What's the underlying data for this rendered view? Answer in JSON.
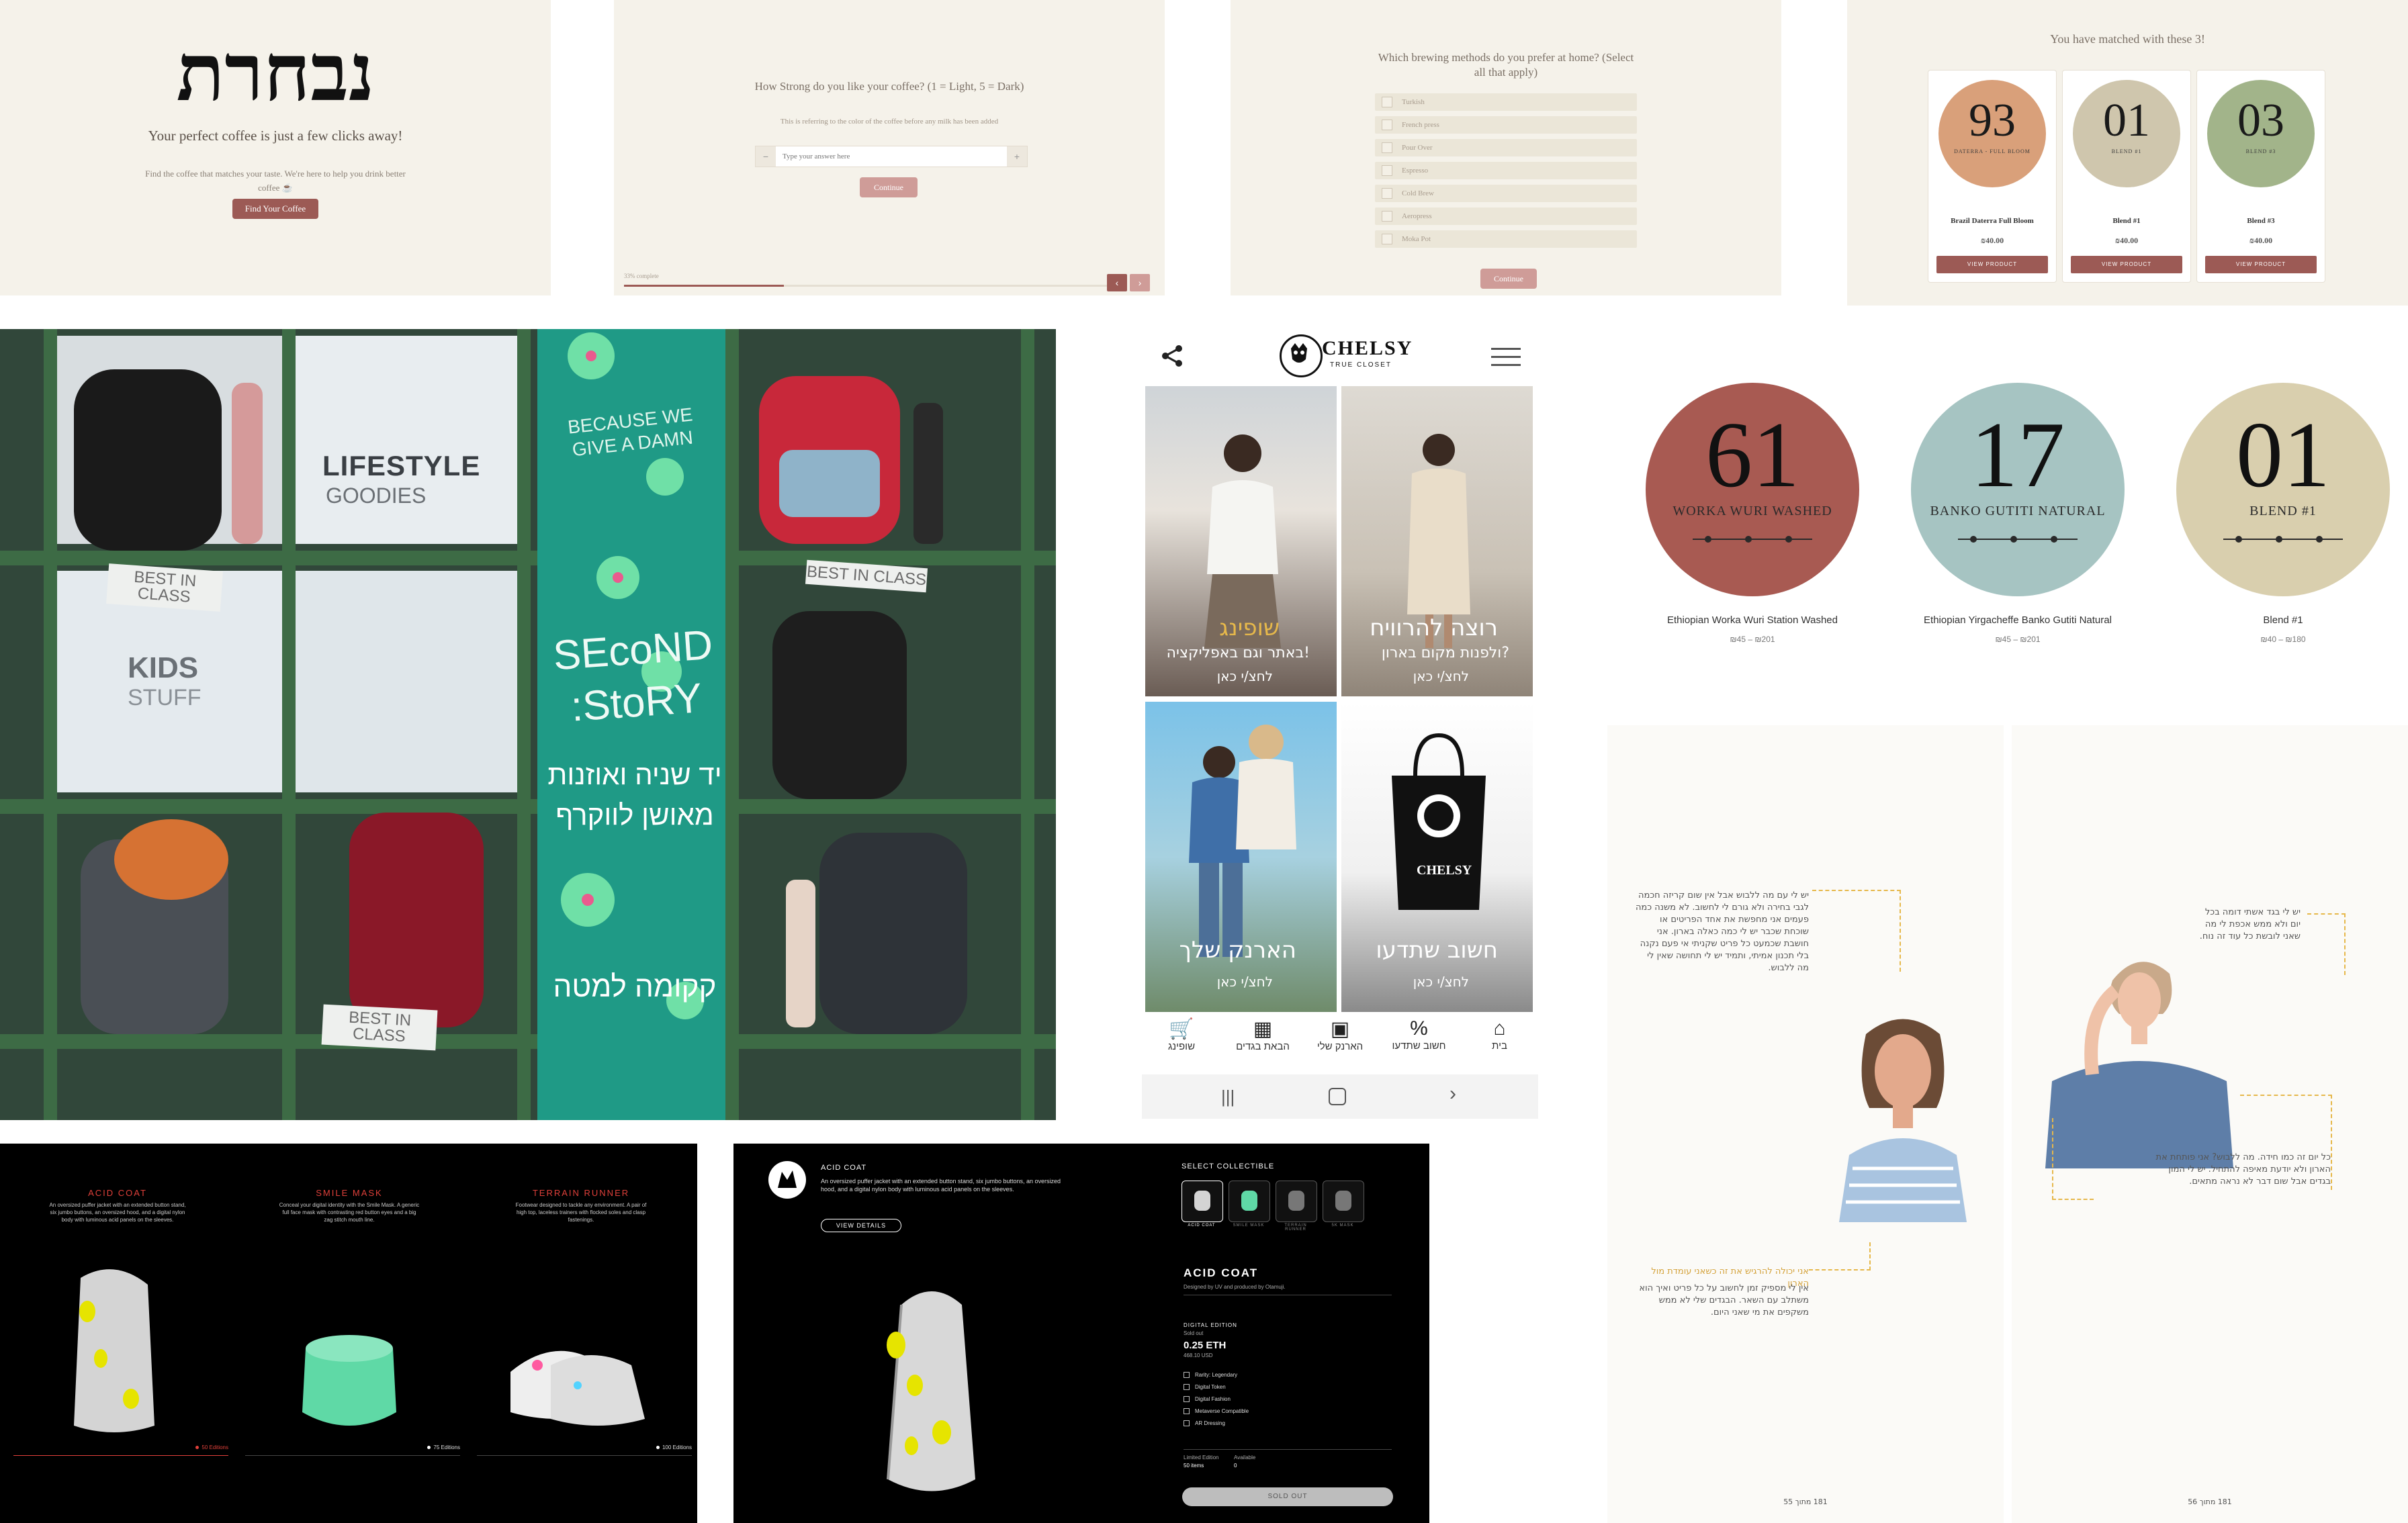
{
  "quiz_intro": {
    "logo": "נבחרת",
    "tagline": "Your perfect coffee is just a few clicks away!",
    "description": "Find the coffee that matches your taste. We're here to help you drink better coffee ☕",
    "cta": "Find Your Coffee"
  },
  "quiz_strength": {
    "question": "How Strong do you like your coffee? (1 = Light, 5 = Dark)",
    "hint": "This is referring to the color of the coffee before any milk has been added",
    "input_placeholder": "Type your answer here",
    "minus": "−",
    "plus": "+",
    "continue": "Continue",
    "progress_text": "33% complete",
    "progress_value": 0.33,
    "prev": "‹",
    "next": "›"
  },
  "quiz_brewing": {
    "question": "Which brewing methods do you prefer at home? (Select all that apply)",
    "options": [
      "Turkish",
      "French press",
      "Pour Over",
      "Espresso",
      "Cold Brew",
      "Aeropress",
      "Moka Pot"
    ],
    "continue": "Continue"
  },
  "quiz_results": {
    "title": "You have matched with these 3!",
    "products": [
      {
        "score": "93",
        "label": "DATERRA - FULL BLOOM",
        "color": "#d9a07a",
        "name": "Brazil Daterra Full Bloom",
        "price": "₪40.00",
        "button": "VIEW PRODUCT"
      },
      {
        "score": "01",
        "label": "BLEND #1",
        "color": "#cfc6ad",
        "name": "Blend #1",
        "price": "₪40.00",
        "button": "VIEW PRODUCT"
      },
      {
        "score": "03",
        "label": "BLEND #3",
        "color": "#a2b48a",
        "name": "Blend #3",
        "price": "₪40.00",
        "button": "VIEW PRODUCT"
      }
    ]
  },
  "labels": {
    "items": [
      {
        "score": "61",
        "label": "WORKA WURI WASHED",
        "color": "#a85a52",
        "name": "Ethiopian Worka Wuri Station Washed",
        "price": "₪45 – ₪201"
      },
      {
        "score": "17",
        "label": "BANKO GUTITI NATURAL",
        "color": "#a6c4c2",
        "name": "Ethiopian Yirgacheffe Banko Gutiti Natural",
        "price": "₪45 – ₪201"
      },
      {
        "score": "01",
        "label": "BLEND #1",
        "color": "#d9cfae",
        "name": "Blend #1",
        "price": "₪40 – ₪180"
      }
    ]
  },
  "store_photo": {
    "sign_lifestyle": "LIFESTYLE",
    "sign_goodies": "GOODIES",
    "sign_kids": "KIDS",
    "sign_stuff": "STUFF",
    "banner_top": "BECAUSE WE GIVE A DAMN",
    "banner_mid": "SEcoND :StoRY",
    "banner_heb1": "יד שניה ואוזנות",
    "banner_heb2": "מאושן לווקרף",
    "banner_heb3": "קקומה למטה",
    "best_in_class": "BEST IN CLASS"
  },
  "chelsy": {
    "brand": "CHELSY",
    "subbrand": "TRUE CLOSET",
    "tiles": [
      {
        "title": "שופינג",
        "sub": "באתר וגם באפליקציה!",
        "cta": "לחצ/י כאן"
      },
      {
        "title": "רוצה להרוויח",
        "sub": "ולפנות מקום בארון?",
        "cta": "לחצ/י כאן"
      },
      {
        "title": "הארנק שלך",
        "sub": "",
        "cta": "לחצ/י כאן"
      },
      {
        "title": "חשוב שתדעו",
        "sub": "",
        "cta": "לחצ/י כאן"
      }
    ],
    "bag_brand": "CHELSY",
    "nav": [
      "שופינג",
      "הבאת בגדים",
      "הארנק שלי",
      "חשוב שתדעו",
      "בית"
    ]
  },
  "nft_list": {
    "items": [
      {
        "title": "ACID COAT",
        "desc": "An oversized puffer jacket with an extended button stand, six jumbo buttons, an oversized hood, and a digital nylon body with luminous acid panels on the sleeves.",
        "editions": "50 Editions",
        "dot": "#e0403a"
      },
      {
        "title": "SMILE MASK",
        "desc": "Conceal your digital identity with the Smile Mask. A generic full face mask with contrasting red button eyes and a big zag stitch mouth line.",
        "editions": "75 Editions",
        "dot": "#ffffff"
      },
      {
        "title": "TERRAIN RUNNER",
        "desc": "Footwear designed to tackle any environment. A pair of high top, laceless trainers with flocked soles and clasp fastenings.",
        "editions": "100 Editions",
        "dot": "#ffffff"
      }
    ]
  },
  "nft_detail": {
    "header_title": "ACID COAT",
    "header_desc": "An oversized puffer jacket with an extended button stand, six jumbo buttons, an oversized hood, and a digital nylon body with luminous acid panels on the sleeves.",
    "view_details": "VIEW DETAILS",
    "select_label": "SELECT COLLECTIBLE",
    "thumbs": [
      "ACID COAT",
      "SMILE MASK",
      "TERRAIN RUNNER",
      "5K MASK"
    ],
    "name": "ACID COAT",
    "designed_by": "Designed by UV and produced by Otamuji.",
    "edition_label": "DIGITAL EDITION",
    "sold_out_note": "Sold out",
    "price": "0.25 ETH",
    "usd": "468.10 USD",
    "features": [
      "Rarity: Legendary",
      "Digital Token",
      "Digital Fashion",
      "Metaverse Compatible",
      "AR Dressing"
    ],
    "limited_label": "Limited Edition",
    "limited_value": "50 items",
    "available_label": "Available",
    "available_value": "0",
    "sold_out": "SOLD OUT"
  },
  "book": {
    "left_text": "יש לי עם מה ללבוש אבל אין שום קריזה חכמה לגבי בחירה ולא גורם לי לחשוב. לא משנה כמה פעמים אני מחפשת את אחד הפריטים או שוכחת שכבר יש לי כמה כאלה בארון. אני חושבת שכמעט כל פריט שקניתי אי פעם נקנה בלי תכנון אמיתי, ותמיד יש לי תחושה שאין לי מה ללבוש.",
    "left_text2": "אני יכולה להרגיש את זה כשאני עומדת מול הארון",
    "left_text3": "אין לי מספיק זמן לחשוב על כל פריט ואיך הוא משתלב עם השאר. הבגדים שלי לא ממש משקפים את מי שאני היום.",
    "right_text1": "יש לי בגד אשתי דומה בכל יום ולא ממש אכפת לי מה שאני לובשת כל עוד זה נוח.",
    "right_text2": "כל יום זה כמו חידה. מה ללבוש? אני פותחת את הארון ולא יודעת מאיפה להתחיל. יש לי המון בגדים אבל שום דבר לא נראה מתאים.",
    "page_left": "181 מתוך 55",
    "page_right": "181 מתוך 56"
  }
}
